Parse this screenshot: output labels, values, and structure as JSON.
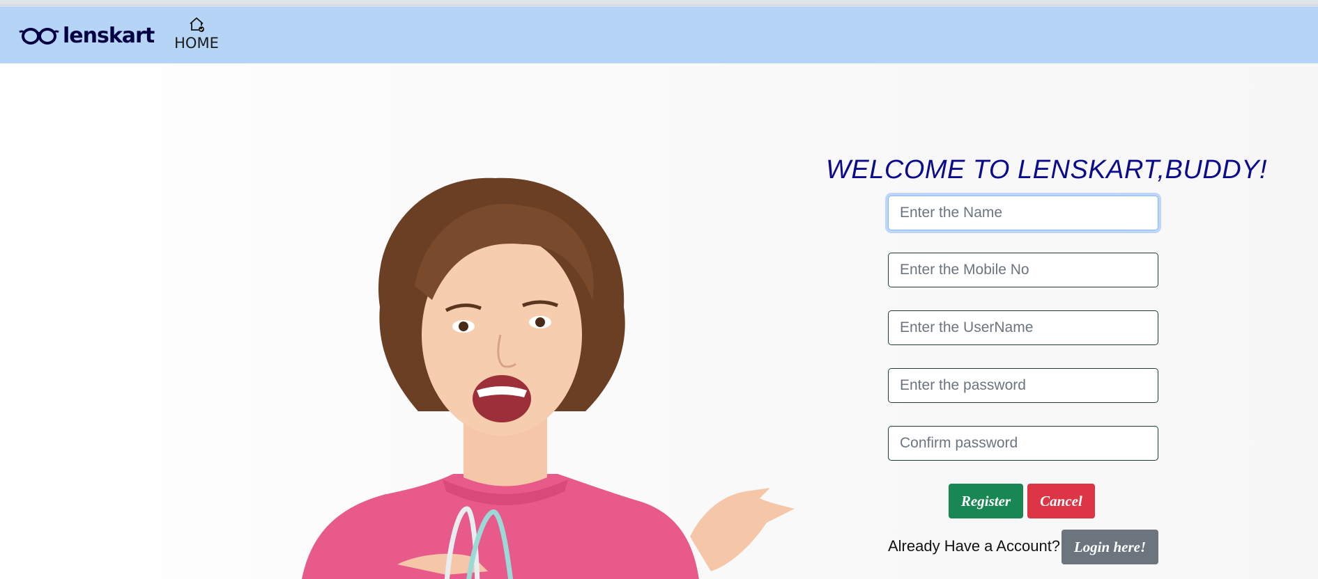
{
  "brand": {
    "name": "lenskart",
    "logo_icon": "glasses-logo-icon",
    "color": "#000042"
  },
  "nav": {
    "home_label": "HOME",
    "home_icon": "home-icon",
    "background": "#b6d4f6"
  },
  "form": {
    "title": "WELCOME TO LENSKART,BUDDY!",
    "fields": {
      "name": {
        "placeholder": "Enter the Name",
        "value": ""
      },
      "mobile": {
        "placeholder": "Enter the Mobile No",
        "value": ""
      },
      "username": {
        "placeholder": "Enter the UserName",
        "value": ""
      },
      "password": {
        "placeholder": "Enter the password",
        "value": ""
      },
      "confirm": {
        "placeholder": "Confirm password",
        "value": ""
      }
    },
    "register_label": "Register",
    "cancel_label": "Cancel",
    "account_prompt": "Already Have a Account?",
    "login_label": "Login here!"
  },
  "colors": {
    "title": "#0b0b8c",
    "register": "#198754",
    "cancel": "#dc3545",
    "login": "#6c757d"
  }
}
